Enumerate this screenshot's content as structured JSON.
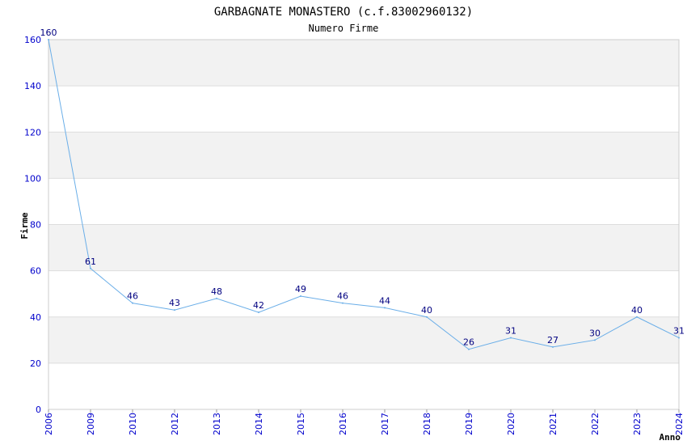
{
  "chart_data": {
    "type": "line",
    "title": "GARBAGNATE MONASTERO (c.f.83002960132)",
    "subtitle": "Numero Firme",
    "xlabel": "Anno",
    "ylabel": "Firme",
    "categories": [
      "2006",
      "2009",
      "2010",
      "2012",
      "2013",
      "2014",
      "2015",
      "2016",
      "2017",
      "2018",
      "2019",
      "2020",
      "2021",
      "2022",
      "2023",
      "2024"
    ],
    "series": [
      {
        "values": [
          160,
          61,
          46,
          43,
          48,
          42,
          49,
          46,
          44,
          40,
          26,
          31,
          27,
          30,
          40,
          31
        ]
      }
    ],
    "ylim": [
      0,
      160
    ],
    "yticks": [
      0,
      20,
      40,
      60,
      80,
      100,
      120,
      140,
      160
    ],
    "grid": true,
    "colors": {
      "line": "#6aaee8",
      "band": "#f2f2f2",
      "tick_label": "#0000cc",
      "data_label": "#000080",
      "text": "#000000"
    }
  }
}
